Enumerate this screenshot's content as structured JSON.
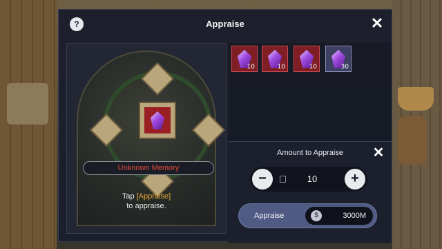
{
  "header": {
    "title": "Appraise",
    "help_icon": "?",
    "close_icon": "✕"
  },
  "item": {
    "name": "Unknown Memory",
    "name_color": "#e0473a",
    "icon": "purple-crystal-icon"
  },
  "hint": {
    "tap": "Tap ",
    "button_ref": "[Appraise]",
    "line2": "to appraise.",
    "highlight_color": "#e6a935"
  },
  "inventory": [
    {
      "icon": "purple-crystal-icon",
      "qty": "10"
    },
    {
      "icon": "purple-crystal-icon",
      "qty": "10"
    },
    {
      "icon": "purple-crystal-icon",
      "qty": "10"
    },
    {
      "icon": "purple-crystal-icon",
      "qty": "30"
    }
  ],
  "amount": {
    "title": "Amount to Appraise",
    "value": "10",
    "minus": "−",
    "plus": "+",
    "close_icon": "✕"
  },
  "appraise": {
    "label": "Appraise",
    "cost": "3000M",
    "currency_icon": "$"
  }
}
